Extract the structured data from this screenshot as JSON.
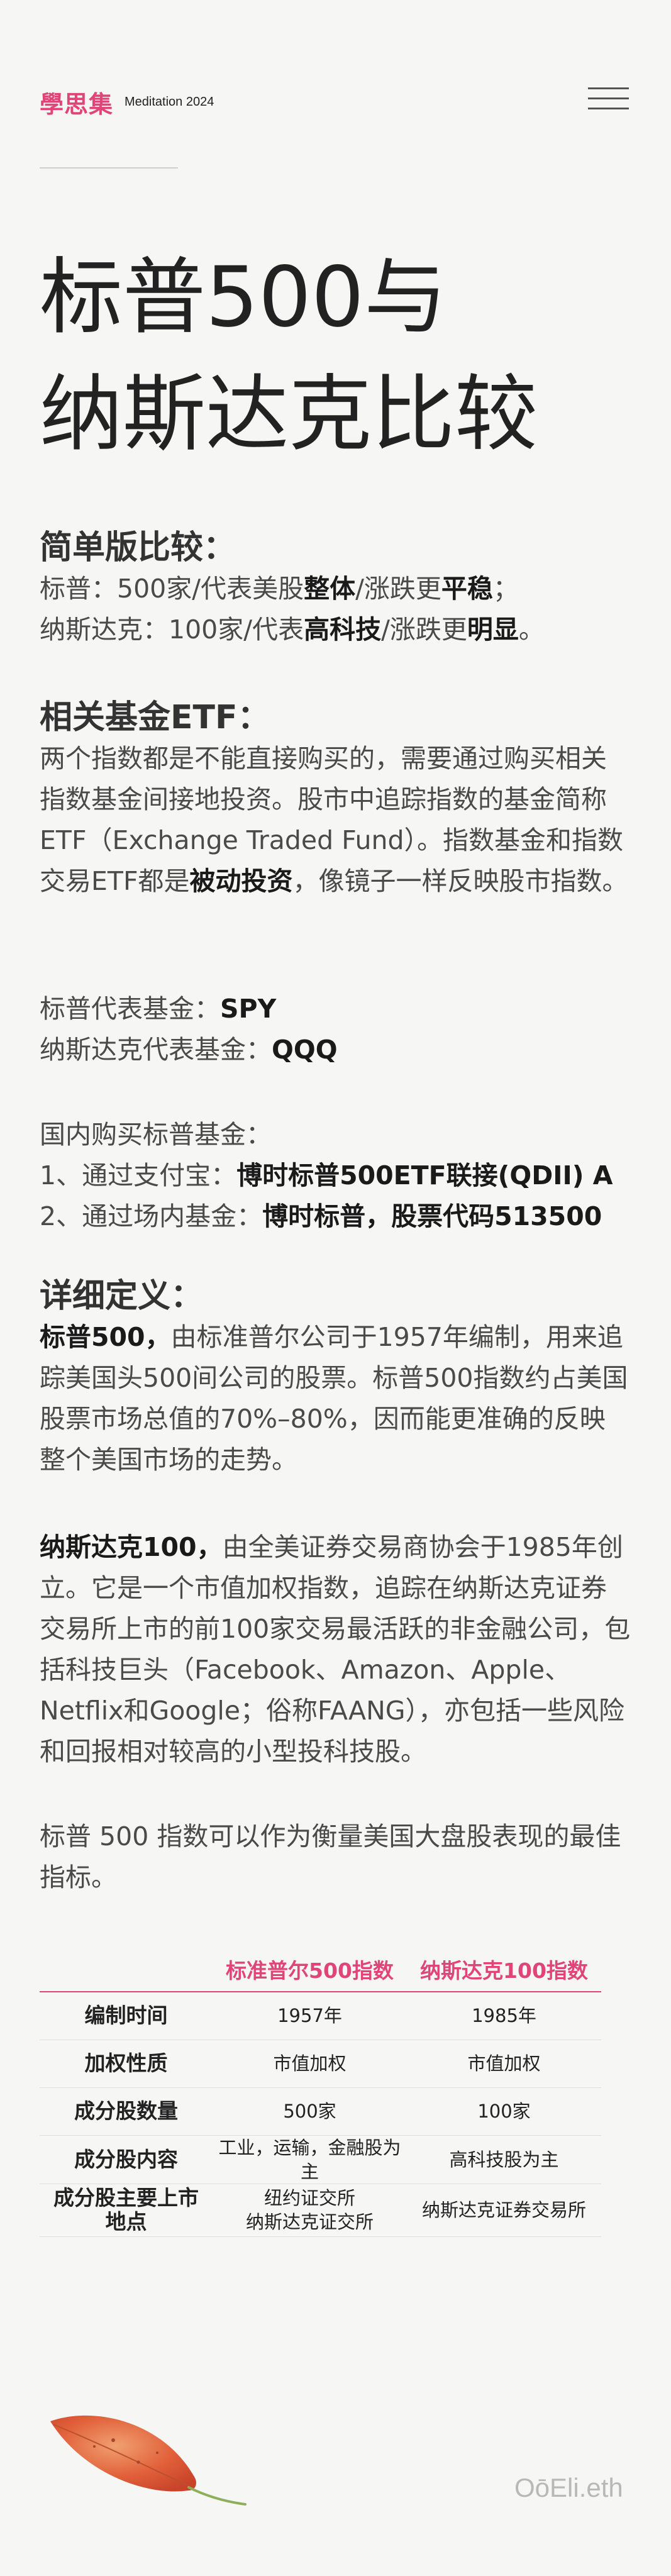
{
  "header": {
    "brand_logo": "學思集",
    "brand_sub": "Meditation 2024"
  },
  "title": {
    "line1": "标普500与",
    "line2": "纳斯达克比较"
  },
  "simple": {
    "heading": "简单版比较：",
    "l1_a": "标普：500家/代表美股",
    "l1_b": "整体",
    "l1_c": "/涨跌更",
    "l1_d": "平稳",
    "l1_e": "；",
    "l2_a": "纳斯达克：100家/代表",
    "l2_b": "高科技",
    "l2_c": "/涨跌更",
    "l2_d": "明显",
    "l2_e": "。"
  },
  "etf": {
    "heading": "相关基金ETF：",
    "p1_a": "两个指数都是不能直接购买的，需要通过购买相关指数基金间接地投资。股市中追踪指数的基金简称ETF（Exchange Traded Fund）。指数基金和指数交易ETF都是",
    "p1_b": "被动投资",
    "p1_c": "，像镜子一样反映股市指数。",
    "spy_label": "标普代表基金：",
    "spy_value": "SPY",
    "qqq_label": "纳斯达克代表基金：",
    "qqq_value": "QQQ",
    "domestic_title": "国内购买标普基金：",
    "d1_label": "1、通过支付宝：",
    "d1_value": "博时标普500ETF联接(QDII) A",
    "d2_label": "2、通过场内基金：",
    "d2_value": "博时标普，股票代码513500"
  },
  "detail": {
    "heading": "详细定义：",
    "sp_name": "标普500，",
    "sp_text": "由标准普尔公司于1957年编制，用来追踪美国头500间公司的股票。标普500指数约占美国股票市场总值的70%–80%，因而能更准确的反映整个美国市场的走势。",
    "nq_name": "纳斯达克100，",
    "nq_text": "由全美证券交易商协会于1985年创立。它是一个市值加权指数，追踪在纳斯达克证券交易所上市的前100家交易最活跃的非金融公司，包括科技巨头（Facebook、Amazon、Apple、Netflix和Google；俗称FAANG），亦包括一些风险和回报相对较高的小型投科技股。",
    "conclusion": "标普 500 指数可以作为衡量美国大盘股表现的最佳指标。"
  },
  "table": {
    "headers": [
      "",
      "标准普尔500指数",
      "纳斯达克100指数"
    ],
    "rows": [
      [
        "编制时间",
        "1957年",
        "1985年"
      ],
      [
        "加权性质",
        "市值加权",
        "市值加权"
      ],
      [
        "成分股数量",
        "500家",
        "100家"
      ],
      [
        "成分股内容",
        "工业，运输，金融股为主",
        "高科技股为主"
      ],
      [
        "成分股主要上市地点",
        "纽约证交所\n纳斯达克证交所",
        "纳斯达克证券交易所"
      ]
    ]
  },
  "footer": {
    "signature": "OōEli.eth"
  },
  "colors": {
    "accent": "#e0457a",
    "background": "#f6f6f5",
    "text": "#3a3a3a"
  }
}
